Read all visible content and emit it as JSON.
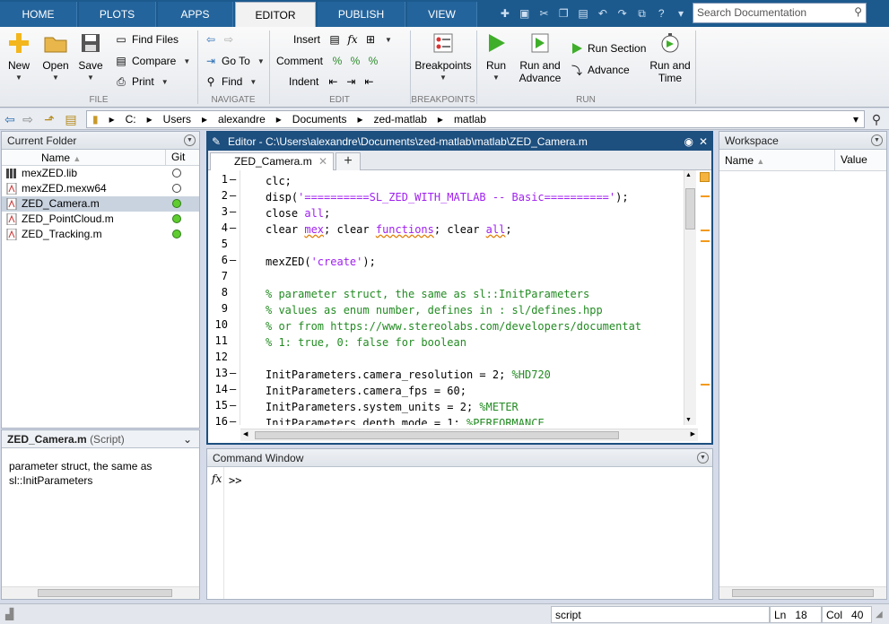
{
  "tabs": [
    "HOME",
    "PLOTS",
    "APPS",
    "EDITOR",
    "PUBLISH",
    "VIEW"
  ],
  "search": {
    "placeholder": "Search Documentation"
  },
  "ribbon": {
    "file": {
      "label": "FILE",
      "new": "New",
      "open": "Open",
      "save": "Save",
      "find_files": "Find Files",
      "compare": "Compare",
      "print": "Print"
    },
    "navigate": {
      "label": "NAVIGATE",
      "go_to": "Go To",
      "find": "Find"
    },
    "edit": {
      "label": "EDIT",
      "insert": "Insert",
      "comment": "Comment",
      "indent": "Indent",
      "fx": "fx"
    },
    "breakpoints": {
      "label": "BREAKPOINTS",
      "breakpoints": "Breakpoints"
    },
    "run": {
      "label": "RUN",
      "run": "Run",
      "run_and": "Run and",
      "advance_word": "Advance",
      "run_section": "Run Section",
      "advance": "Advance",
      "run_and_time_1": "Run and",
      "run_and_time_2": "Time"
    }
  },
  "path": [
    "C:",
    "Users",
    "alexandre",
    "Documents",
    "zed-matlab",
    "matlab"
  ],
  "current_folder": {
    "title": "Current Folder",
    "col_name": "Name",
    "col_git": "Git",
    "files": [
      {
        "name": "mexZED.lib",
        "git": "none"
      },
      {
        "name": "mexZED.mexw64",
        "git": "none"
      },
      {
        "name": "ZED_Camera.m",
        "git": "green"
      },
      {
        "name": "ZED_PointCloud.m",
        "git": "green"
      },
      {
        "name": "ZED_Tracking.m",
        "git": "green"
      }
    ],
    "details_title": "ZED_Camera.m",
    "details_kind": "(Script)",
    "details_text": "parameter struct, the same as sl::InitParameters"
  },
  "editor": {
    "title": "Editor - C:\\Users\\alexandre\\Documents\\zed-matlab\\matlab\\ZED_Camera.m",
    "tab": "ZED_Camera.m",
    "line_numbers": [
      "1",
      "2",
      "3",
      "4",
      "5",
      "6",
      "7",
      "8",
      "9",
      "10",
      "11",
      "12",
      "13",
      "14",
      "15",
      "16"
    ]
  },
  "command_window": {
    "title": "Command Window",
    "prompt": ">>",
    "fx": "fx"
  },
  "workspace": {
    "title": "Workspace",
    "col_name": "Name",
    "col_value": "Value"
  },
  "status": {
    "mode": "script",
    "ln_label": "Ln",
    "ln": "18",
    "col_label": "Col",
    "col": "40"
  }
}
